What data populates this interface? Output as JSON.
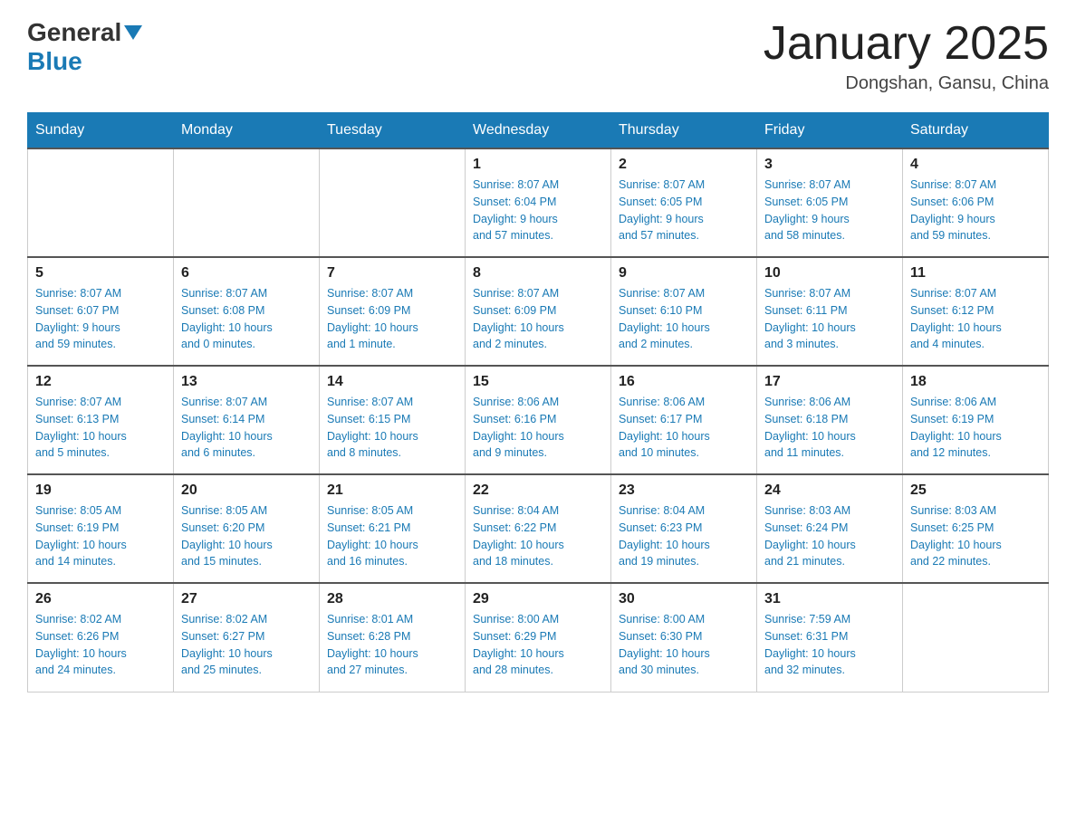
{
  "header": {
    "logo_general": "General",
    "logo_blue": "Blue",
    "month_title": "January 2025",
    "location": "Dongshan, Gansu, China"
  },
  "days_of_week": [
    "Sunday",
    "Monday",
    "Tuesday",
    "Wednesday",
    "Thursday",
    "Friday",
    "Saturday"
  ],
  "weeks": [
    [
      {
        "day": "",
        "info": ""
      },
      {
        "day": "",
        "info": ""
      },
      {
        "day": "",
        "info": ""
      },
      {
        "day": "1",
        "info": "Sunrise: 8:07 AM\nSunset: 6:04 PM\nDaylight: 9 hours\nand 57 minutes."
      },
      {
        "day": "2",
        "info": "Sunrise: 8:07 AM\nSunset: 6:05 PM\nDaylight: 9 hours\nand 57 minutes."
      },
      {
        "day": "3",
        "info": "Sunrise: 8:07 AM\nSunset: 6:05 PM\nDaylight: 9 hours\nand 58 minutes."
      },
      {
        "day": "4",
        "info": "Sunrise: 8:07 AM\nSunset: 6:06 PM\nDaylight: 9 hours\nand 59 minutes."
      }
    ],
    [
      {
        "day": "5",
        "info": "Sunrise: 8:07 AM\nSunset: 6:07 PM\nDaylight: 9 hours\nand 59 minutes."
      },
      {
        "day": "6",
        "info": "Sunrise: 8:07 AM\nSunset: 6:08 PM\nDaylight: 10 hours\nand 0 minutes."
      },
      {
        "day": "7",
        "info": "Sunrise: 8:07 AM\nSunset: 6:09 PM\nDaylight: 10 hours\nand 1 minute."
      },
      {
        "day": "8",
        "info": "Sunrise: 8:07 AM\nSunset: 6:09 PM\nDaylight: 10 hours\nand 2 minutes."
      },
      {
        "day": "9",
        "info": "Sunrise: 8:07 AM\nSunset: 6:10 PM\nDaylight: 10 hours\nand 2 minutes."
      },
      {
        "day": "10",
        "info": "Sunrise: 8:07 AM\nSunset: 6:11 PM\nDaylight: 10 hours\nand 3 minutes."
      },
      {
        "day": "11",
        "info": "Sunrise: 8:07 AM\nSunset: 6:12 PM\nDaylight: 10 hours\nand 4 minutes."
      }
    ],
    [
      {
        "day": "12",
        "info": "Sunrise: 8:07 AM\nSunset: 6:13 PM\nDaylight: 10 hours\nand 5 minutes."
      },
      {
        "day": "13",
        "info": "Sunrise: 8:07 AM\nSunset: 6:14 PM\nDaylight: 10 hours\nand 6 minutes."
      },
      {
        "day": "14",
        "info": "Sunrise: 8:07 AM\nSunset: 6:15 PM\nDaylight: 10 hours\nand 8 minutes."
      },
      {
        "day": "15",
        "info": "Sunrise: 8:06 AM\nSunset: 6:16 PM\nDaylight: 10 hours\nand 9 minutes."
      },
      {
        "day": "16",
        "info": "Sunrise: 8:06 AM\nSunset: 6:17 PM\nDaylight: 10 hours\nand 10 minutes."
      },
      {
        "day": "17",
        "info": "Sunrise: 8:06 AM\nSunset: 6:18 PM\nDaylight: 10 hours\nand 11 minutes."
      },
      {
        "day": "18",
        "info": "Sunrise: 8:06 AM\nSunset: 6:19 PM\nDaylight: 10 hours\nand 12 minutes."
      }
    ],
    [
      {
        "day": "19",
        "info": "Sunrise: 8:05 AM\nSunset: 6:19 PM\nDaylight: 10 hours\nand 14 minutes."
      },
      {
        "day": "20",
        "info": "Sunrise: 8:05 AM\nSunset: 6:20 PM\nDaylight: 10 hours\nand 15 minutes."
      },
      {
        "day": "21",
        "info": "Sunrise: 8:05 AM\nSunset: 6:21 PM\nDaylight: 10 hours\nand 16 minutes."
      },
      {
        "day": "22",
        "info": "Sunrise: 8:04 AM\nSunset: 6:22 PM\nDaylight: 10 hours\nand 18 minutes."
      },
      {
        "day": "23",
        "info": "Sunrise: 8:04 AM\nSunset: 6:23 PM\nDaylight: 10 hours\nand 19 minutes."
      },
      {
        "day": "24",
        "info": "Sunrise: 8:03 AM\nSunset: 6:24 PM\nDaylight: 10 hours\nand 21 minutes."
      },
      {
        "day": "25",
        "info": "Sunrise: 8:03 AM\nSunset: 6:25 PM\nDaylight: 10 hours\nand 22 minutes."
      }
    ],
    [
      {
        "day": "26",
        "info": "Sunrise: 8:02 AM\nSunset: 6:26 PM\nDaylight: 10 hours\nand 24 minutes."
      },
      {
        "day": "27",
        "info": "Sunrise: 8:02 AM\nSunset: 6:27 PM\nDaylight: 10 hours\nand 25 minutes."
      },
      {
        "day": "28",
        "info": "Sunrise: 8:01 AM\nSunset: 6:28 PM\nDaylight: 10 hours\nand 27 minutes."
      },
      {
        "day": "29",
        "info": "Sunrise: 8:00 AM\nSunset: 6:29 PM\nDaylight: 10 hours\nand 28 minutes."
      },
      {
        "day": "30",
        "info": "Sunrise: 8:00 AM\nSunset: 6:30 PM\nDaylight: 10 hours\nand 30 minutes."
      },
      {
        "day": "31",
        "info": "Sunrise: 7:59 AM\nSunset: 6:31 PM\nDaylight: 10 hours\nand 32 minutes."
      },
      {
        "day": "",
        "info": ""
      }
    ]
  ]
}
